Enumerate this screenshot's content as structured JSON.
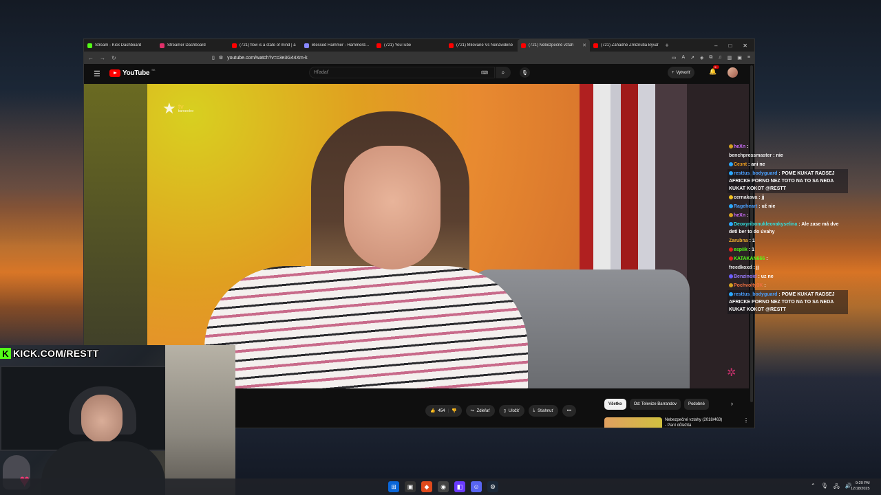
{
  "browser": {
    "tabs": [
      {
        "title": "Stream - Kick Dashboard",
        "color": "#53fc18",
        "active": false
      },
      {
        "title": "Streamer Dashboard",
        "color": "#e0306a",
        "active": false
      },
      {
        "title": "(721) flow is a state of mind | a",
        "color": "#ff0000",
        "active": false
      },
      {
        "title": "Blessed Hammer - Hammerdun",
        "color": "#8888ff",
        "active": false
      },
      {
        "title": "(721) YouTube",
        "color": "#ff0000",
        "active": false
      },
      {
        "title": "(721) Milované Vs Nenávidéné",
        "color": "#ff0000",
        "active": false
      },
      {
        "title": "(721) Nebezpečné vztah",
        "color": "#ff0000",
        "active": true
      },
      {
        "title": "(721) Záhadné Zmiznutia Bývaľ",
        "color": "#ff0000",
        "active": false
      }
    ],
    "new_tab": "+",
    "window_controls": [
      "–",
      "□",
      "✕"
    ],
    "url": "youtube.com/watch?v=c3e3G44Xm-k"
  },
  "youtube": {
    "logo_text": "YouTube",
    "country": "SK",
    "search_placeholder": "Hľadať",
    "create_label": "Vytvoriť",
    "notif_count": "9+",
    "channel_watermark": {
      "tv": "tv",
      "sub": "barrandov"
    },
    "actions": {
      "likes": "454",
      "share": "Zdieľať",
      "save": "Uložiť",
      "download": "Stiahnuť",
      "more": "•••"
    },
    "chips": [
      {
        "label": "Všetko",
        "selected": true
      },
      {
        "label": "Od: Televize Barrandov",
        "selected": false
      },
      {
        "label": "Podobné",
        "selected": false
      }
    ],
    "recommendation": {
      "title": "Nebezpečné vztahy (2018/463)",
      "subtitle": "- Paní důležitá"
    }
  },
  "chat": [
    {
      "user": "heXn",
      "color": "#d070ff",
      "text": "",
      "badge": "#d4a020",
      "hl": false
    },
    {
      "user": "benchpressmaster",
      "color": "#e8e8e8",
      "text": "nie",
      "badge": "",
      "hl": false
    },
    {
      "user": "Cезnt",
      "color": "#f0a020",
      "text": "ani ne",
      "badge": "#2aa8ff",
      "hl": false
    },
    {
      "user": "resttus_bodyguard",
      "color": "#4aa0ff",
      "text": "POME KUKAT RADSEJ AFRICKE PORNO NEZ TOTO NA TO SA NEDA KUKAT KOKOT @RESTT",
      "badge": "#2aa8ff",
      "hl": true
    },
    {
      "user": "cernakava",
      "color": "#e8e8e8",
      "text": "jj",
      "badge": "#f0c020",
      "hl": false
    },
    {
      "user": "Rageheart",
      "color": "#4aa0ff",
      "text": "už nie",
      "badge": "#2aa8ff",
      "hl": false
    },
    {
      "user": "heXn",
      "color": "#d070ff",
      "text": "",
      "badge": "#d4a020",
      "hl": false
    },
    {
      "user": "Deoxyribonukleovakyselina",
      "color": "#30e0e0",
      "text": "Ale zase má dve deti ber to do úvahy",
      "badge": "#2aa8ff",
      "hl": false
    },
    {
      "user": "Zarubna",
      "color": "#f0b030",
      "text": "1",
      "badge": "",
      "hl": false
    },
    {
      "user": "espiik",
      "color": "#53fc18",
      "text": "1",
      "badge": "#e02020",
      "hl": false
    },
    {
      "user": "KATAKAN666",
      "color": "#53fc18",
      "text": "",
      "badge": "#e02020",
      "hl": false
    },
    {
      "user": "freedkoxd",
      "color": "#e8e8e8",
      "text": "jj",
      "badge": "",
      "hl": false
    },
    {
      "user": "Benzinoid",
      "color": "#9a7cff",
      "text": "uz ne",
      "badge": "#6a5cff",
      "hl": false
    },
    {
      "user": "Pochvolty3K",
      "color": "#f07040",
      "text": "",
      "badge": "#d4a020",
      "hl": false
    },
    {
      "user": "resttus_bodyguard",
      "color": "#4aa0ff",
      "text": "POME KUKAT RADSEJ AFRICKE PORNO NEZ TOTO NA TO SA NEDA KUKAT KOKOT @RESTT",
      "badge": "#2aa8ff",
      "hl": true
    }
  ],
  "overlay": {
    "kick_url": "KICK.COM/RESTT",
    "kick_letter": "K"
  },
  "taskbar": {
    "time": "9:20 PM",
    "date": "12/18/2025"
  }
}
